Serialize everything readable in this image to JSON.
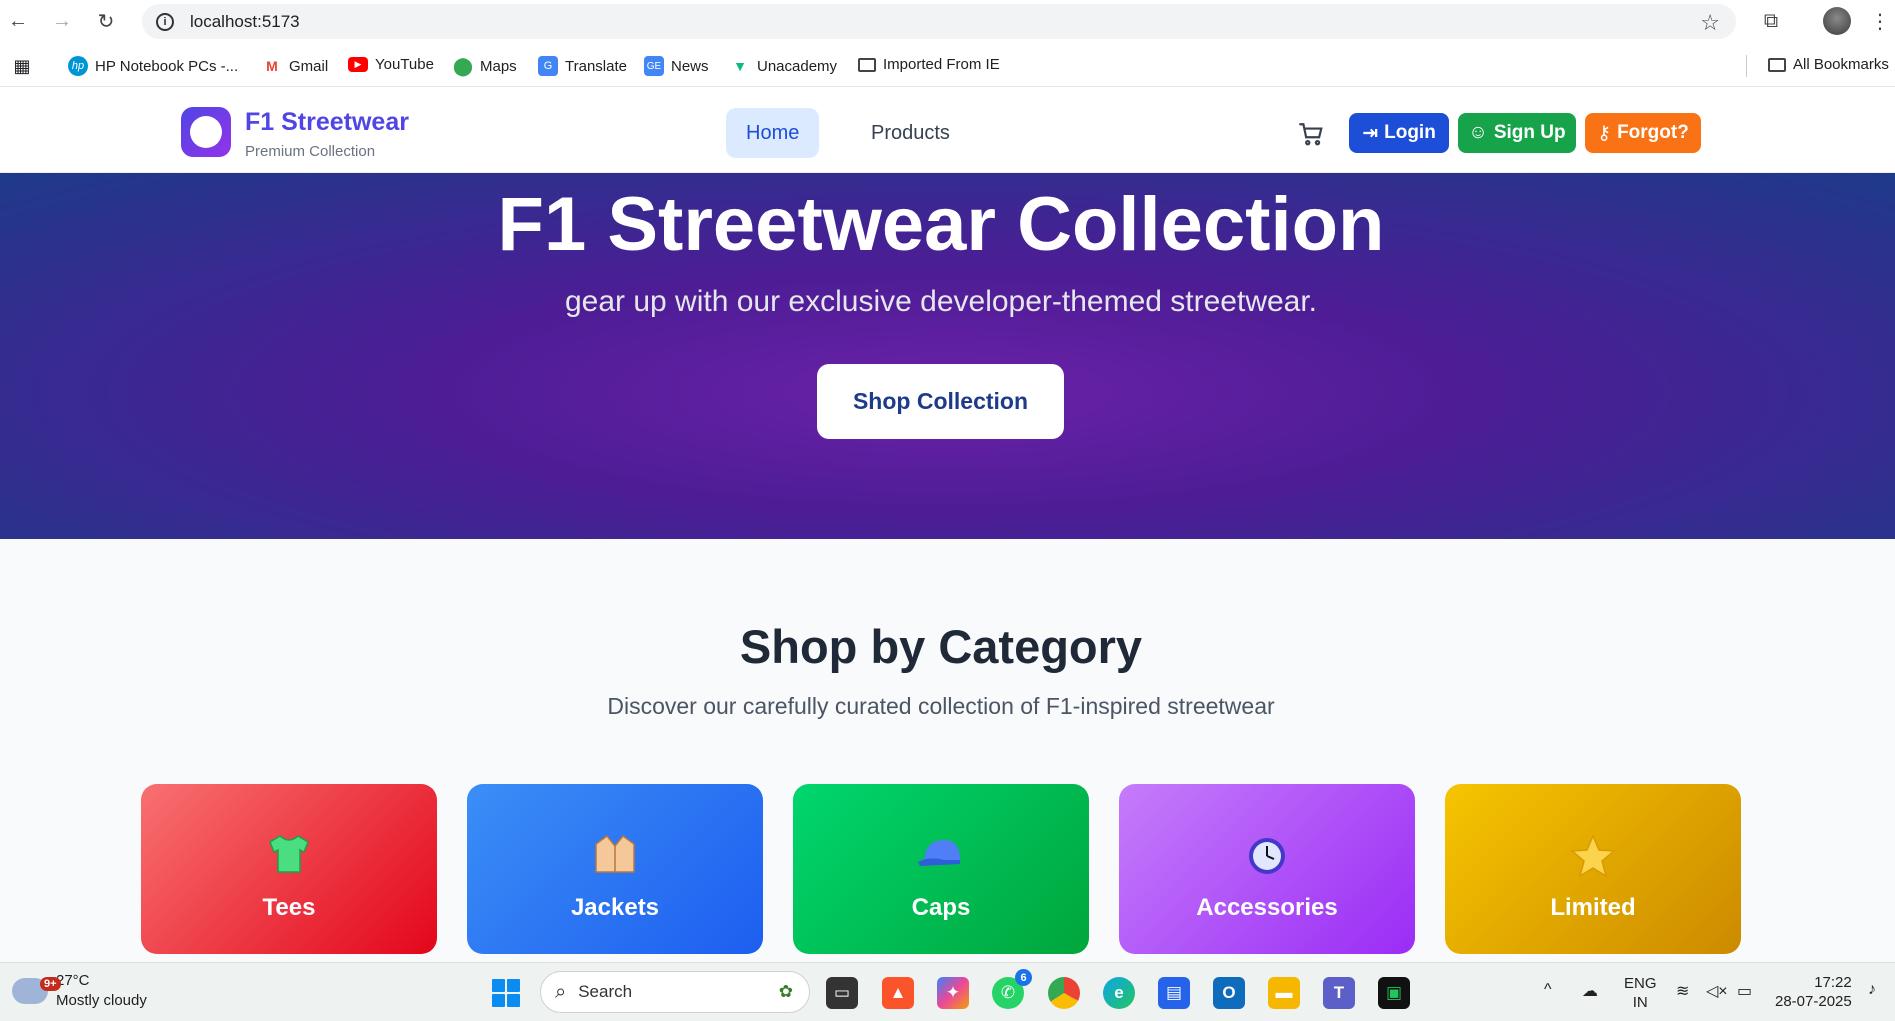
{
  "browser": {
    "url": "localhost:5173",
    "bookmarks": [
      "HP Notebook PCs -...",
      "Gmail",
      "YouTube",
      "Maps",
      "Translate",
      "News",
      "Unacademy",
      "Imported From IE"
    ],
    "all_bookmarks": "All Bookmarks"
  },
  "site": {
    "brand": "F1 Streetwear",
    "brand_sub": "Premium Collection",
    "nav": [
      "Home",
      "Products"
    ],
    "login": "Login",
    "signup": "Sign Up",
    "forgot": "Forgot?"
  },
  "hero": {
    "title": "F1 Streetwear Collection",
    "subtitle": "gear up with our exclusive developer-themed streetwear.",
    "cta": "Shop Collection"
  },
  "categories": {
    "title": "Shop by Category",
    "subtitle": "Discover our carefully curated collection of F1-inspired streetwear",
    "items": [
      {
        "label": "Tees",
        "icon": "tshirt-icon",
        "colors": [
          "#f87171",
          "#dc2626"
        ]
      },
      {
        "label": "Jackets",
        "icon": "jacket-icon",
        "colors": [
          "#3b82f6",
          "#2563eb"
        ]
      },
      {
        "label": "Caps",
        "icon": "cap-icon",
        "colors": [
          "#00d26a",
          "#00a83e"
        ]
      },
      {
        "label": "Accessories",
        "icon": "watch-icon",
        "colors": [
          "#c084fc",
          "#9333ea"
        ]
      },
      {
        "label": "Limited",
        "icon": "star-icon",
        "colors": [
          "#eab308",
          "#ca8a04"
        ]
      }
    ]
  },
  "taskbar": {
    "weather_badge": "9+",
    "temp": "27°C",
    "condition": "Mostly cloudy",
    "search": "Search",
    "whatsapp_badge": "6",
    "lang1": "ENG",
    "lang2": "IN",
    "time": "17:22",
    "date": "28-07-2025"
  }
}
